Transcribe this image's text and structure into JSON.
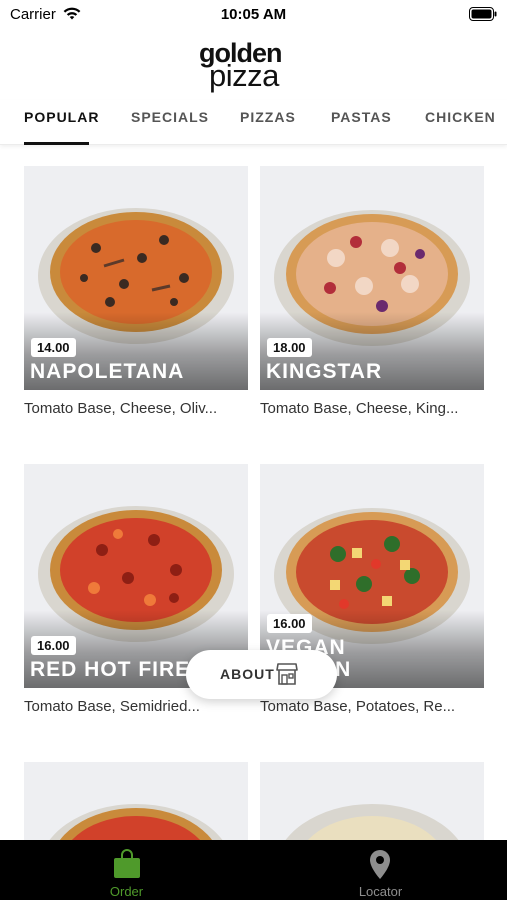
{
  "status_bar": {
    "carrier": "Carrier",
    "time": "10:05 AM"
  },
  "brand": {
    "line1": "golden",
    "line2": "pizza"
  },
  "tabs": [
    {
      "label": "POPULAR",
      "active": true
    },
    {
      "label": "SPECIALS",
      "active": false
    },
    {
      "label": "PIZZAS",
      "active": false
    },
    {
      "label": "PASTAS",
      "active": false
    },
    {
      "label": "CHICKEN",
      "active": false
    }
  ],
  "products": [
    {
      "price": "14.00",
      "name": "NAPOLETANA",
      "description": "Tomato Base, Cheese, Oliv..."
    },
    {
      "price": "18.00",
      "name": "KINGSTAR",
      "description": "Tomato Base, Cheese, King..."
    },
    {
      "price": "16.00",
      "name": "RED HOT FIRE",
      "description": "Tomato Base, Semidried..."
    },
    {
      "price": "16.00",
      "name_line1": "VEGAN",
      "name_line2": "FUSION",
      "description": "Tomato Base, Potatoes, Re..."
    }
  ],
  "floating": {
    "about_label": "ABOUT"
  },
  "bottom_nav": {
    "order_label": "Order",
    "locator_label": "Locator",
    "active_color": "#4f9a2b",
    "inactive_color": "#8e8e8e"
  },
  "icons": [
    "wifi-icon",
    "battery-icon",
    "store-icon",
    "shopping-bag-icon",
    "location-pin-icon"
  ]
}
